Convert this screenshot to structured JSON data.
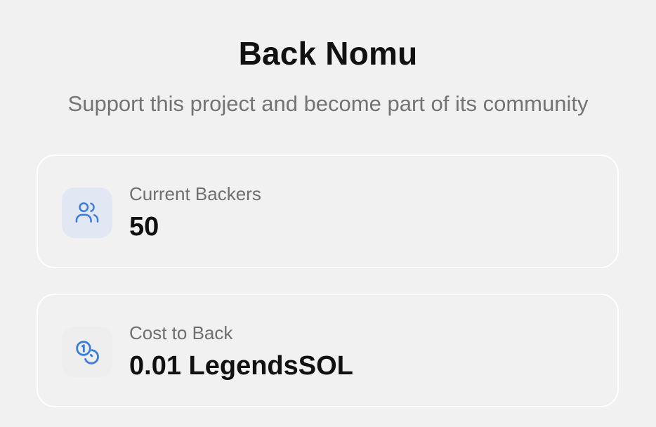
{
  "header": {
    "title": "Back Nomu",
    "subtitle": "Support this project and become part of its community"
  },
  "stats": {
    "backers": {
      "label": "Current Backers",
      "value": "50",
      "icon": "users-icon"
    },
    "cost": {
      "label": "Cost to Back",
      "value": "0.01 LegendsSOL",
      "icon": "coins-icon"
    }
  },
  "colors": {
    "accent": "#3b7ddd",
    "icon_bg": "#e1e8f4",
    "text_primary": "#111111",
    "text_secondary": "#737373"
  }
}
